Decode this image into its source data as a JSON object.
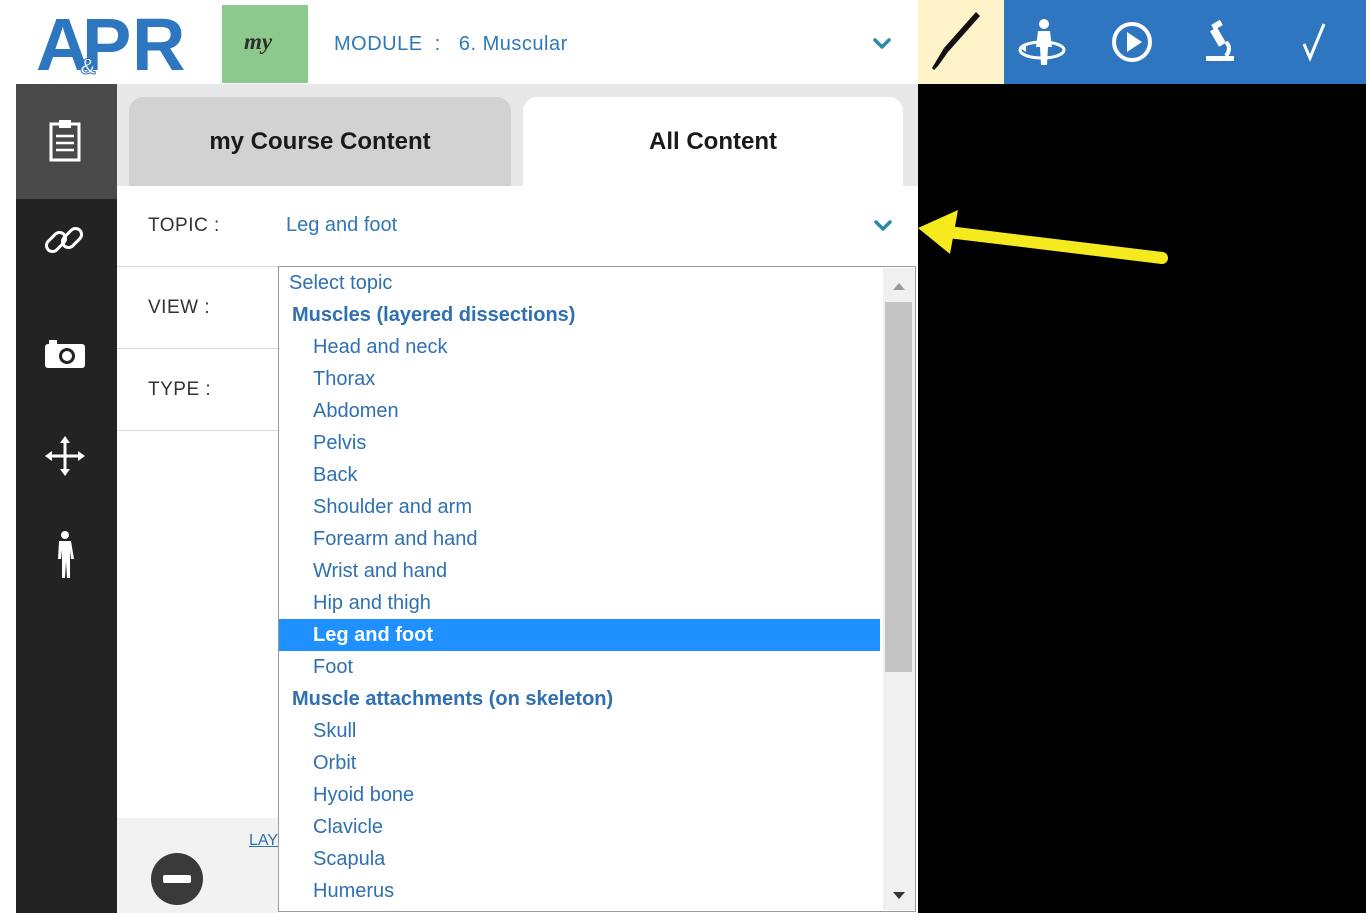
{
  "header": {
    "logo_text": "A&PR",
    "my_label": "my",
    "module_label": "MODULE  :   6. Muscular"
  },
  "tabs": [
    {
      "label": "my Course Content",
      "active": false
    },
    {
      "label": "All Content",
      "active": true
    }
  ],
  "filters": {
    "topic_label": "TOPIC  :",
    "topic_value": "Leg and foot",
    "view_label": "VIEW  :",
    "type_label": "TYPE  :"
  },
  "dropdown": {
    "options": [
      {
        "label": "Select topic",
        "kind": "placeholder"
      },
      {
        "label": "Muscles (layered dissections)",
        "kind": "group"
      },
      {
        "label": "Head and neck",
        "kind": "item"
      },
      {
        "label": "Thorax",
        "kind": "item"
      },
      {
        "label": "Abdomen",
        "kind": "item"
      },
      {
        "label": "Pelvis",
        "kind": "item"
      },
      {
        "label": "Back",
        "kind": "item"
      },
      {
        "label": "Shoulder and arm",
        "kind": "item"
      },
      {
        "label": "Forearm and hand",
        "kind": "item"
      },
      {
        "label": "Wrist and hand",
        "kind": "item"
      },
      {
        "label": "Hip and thigh",
        "kind": "item"
      },
      {
        "label": "Leg and foot",
        "kind": "item",
        "selected": true
      },
      {
        "label": "Foot",
        "kind": "item"
      },
      {
        "label": "Muscle attachments (on skeleton)",
        "kind": "group"
      },
      {
        "label": "Skull",
        "kind": "item"
      },
      {
        "label": "Orbit",
        "kind": "item"
      },
      {
        "label": "Hyoid bone",
        "kind": "item"
      },
      {
        "label": "Clavicle",
        "kind": "item"
      },
      {
        "label": "Scapula",
        "kind": "item"
      },
      {
        "label": "Humerus",
        "kind": "item"
      }
    ]
  },
  "bottom": {
    "layer_label_partial": "LAY"
  },
  "icons": {
    "sidebar": [
      "clipboard-icon",
      "link-icon",
      "camera-icon",
      "move-icon",
      "body-icon"
    ],
    "toolbar": [
      "scalpel-icon",
      "rotate-body-icon",
      "play-icon",
      "microscope-icon",
      "check-icon"
    ]
  },
  "colors": {
    "brand_blue": "#2e76bf",
    "link_blue": "#2f78b8",
    "my_green": "#8cc98d",
    "scalpel_bg": "#fff3c9",
    "selected_bg": "#1e90ff",
    "annotation_arrow": "#f5ea1e"
  }
}
